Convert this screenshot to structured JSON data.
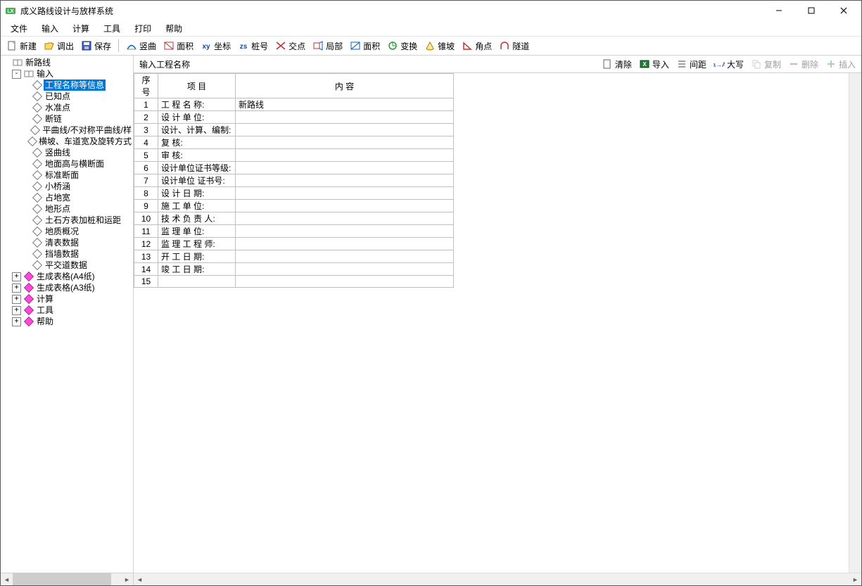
{
  "window": {
    "title": "成义路线设计与放样系统"
  },
  "menu": {
    "items": [
      "文件",
      "输入",
      "计算",
      "工具",
      "打印",
      "帮助"
    ]
  },
  "toolbar": {
    "items": [
      {
        "id": "new",
        "label": "新建"
      },
      {
        "id": "open",
        "label": "调出"
      },
      {
        "id": "save",
        "label": "保存"
      },
      {
        "sep": true
      },
      {
        "id": "vcurve",
        "label": "竖曲"
      },
      {
        "id": "area1",
        "label": "面积"
      },
      {
        "id": "xy",
        "label": "坐标"
      },
      {
        "id": "zs",
        "label": "桩号"
      },
      {
        "id": "jd",
        "label": "交点"
      },
      {
        "id": "local",
        "label": "局部"
      },
      {
        "id": "area2",
        "label": "面积"
      },
      {
        "id": "trans",
        "label": "变换"
      },
      {
        "id": "cone",
        "label": "锥坡"
      },
      {
        "id": "angle",
        "label": "角点"
      },
      {
        "id": "tunnel",
        "label": "隧道"
      }
    ]
  },
  "tree": {
    "root_label": "新路线",
    "input_label": "输入",
    "input_children": [
      "工程名称等信息",
      "已知点",
      "水准点",
      "断链",
      "平曲线/不对称平曲线/样",
      "横坡、车道宽及旋转方式",
      "竖曲线",
      "地面高与横断面",
      "标准断面",
      "小桥涵",
      "占地宽",
      "地形点",
      "土石方表加桩和运距",
      "地质概况",
      "清表数据",
      "挡墙数据",
      "平交道数据"
    ],
    "sections": [
      {
        "label": "生成表格(A4纸)"
      },
      {
        "label": "生成表格(A3纸)"
      },
      {
        "label": "计算"
      },
      {
        "label": "工具"
      },
      {
        "label": "帮助"
      }
    ]
  },
  "right": {
    "title": "输入工程名称",
    "tools": [
      {
        "id": "clear",
        "label": "清除",
        "enabled": true
      },
      {
        "id": "import",
        "label": "导入",
        "enabled": true
      },
      {
        "id": "spacing",
        "label": "间距",
        "enabled": true
      },
      {
        "id": "case",
        "label": "大写",
        "enabled": true
      },
      {
        "id": "copy",
        "label": "复制",
        "enabled": false
      },
      {
        "id": "delete",
        "label": "删除",
        "enabled": false
      },
      {
        "id": "insert",
        "label": "插入",
        "enabled": false
      }
    ]
  },
  "grid": {
    "headers": {
      "seq": "序 号",
      "item": "项   目",
      "content": "内   容"
    },
    "rows": [
      {
        "n": 1,
        "item": "工 程 名 称:",
        "content": "新路线"
      },
      {
        "n": 2,
        "item": "设 计 单 位:",
        "content": ""
      },
      {
        "n": 3,
        "item": "设计、计算、编制:",
        "content": ""
      },
      {
        "n": 4,
        "item": "复       核:",
        "content": ""
      },
      {
        "n": 5,
        "item": "审       核:",
        "content": ""
      },
      {
        "n": 6,
        "item": "设计单位证书等级:",
        "content": ""
      },
      {
        "n": 7,
        "item": "设计单位 证书号:",
        "content": ""
      },
      {
        "n": 8,
        "item": "设 计 日 期:",
        "content": ""
      },
      {
        "n": 9,
        "item": "施 工 单 位:",
        "content": ""
      },
      {
        "n": 10,
        "item": "技 术 负 责 人:",
        "content": ""
      },
      {
        "n": 11,
        "item": "监 理 单 位:",
        "content": ""
      },
      {
        "n": 12,
        "item": "监 理 工 程 师:",
        "content": ""
      },
      {
        "n": 13,
        "item": "开 工 日 期:",
        "content": ""
      },
      {
        "n": 14,
        "item": "竣 工 日 期:",
        "content": ""
      },
      {
        "n": 15,
        "item": "",
        "content": ""
      }
    ]
  }
}
